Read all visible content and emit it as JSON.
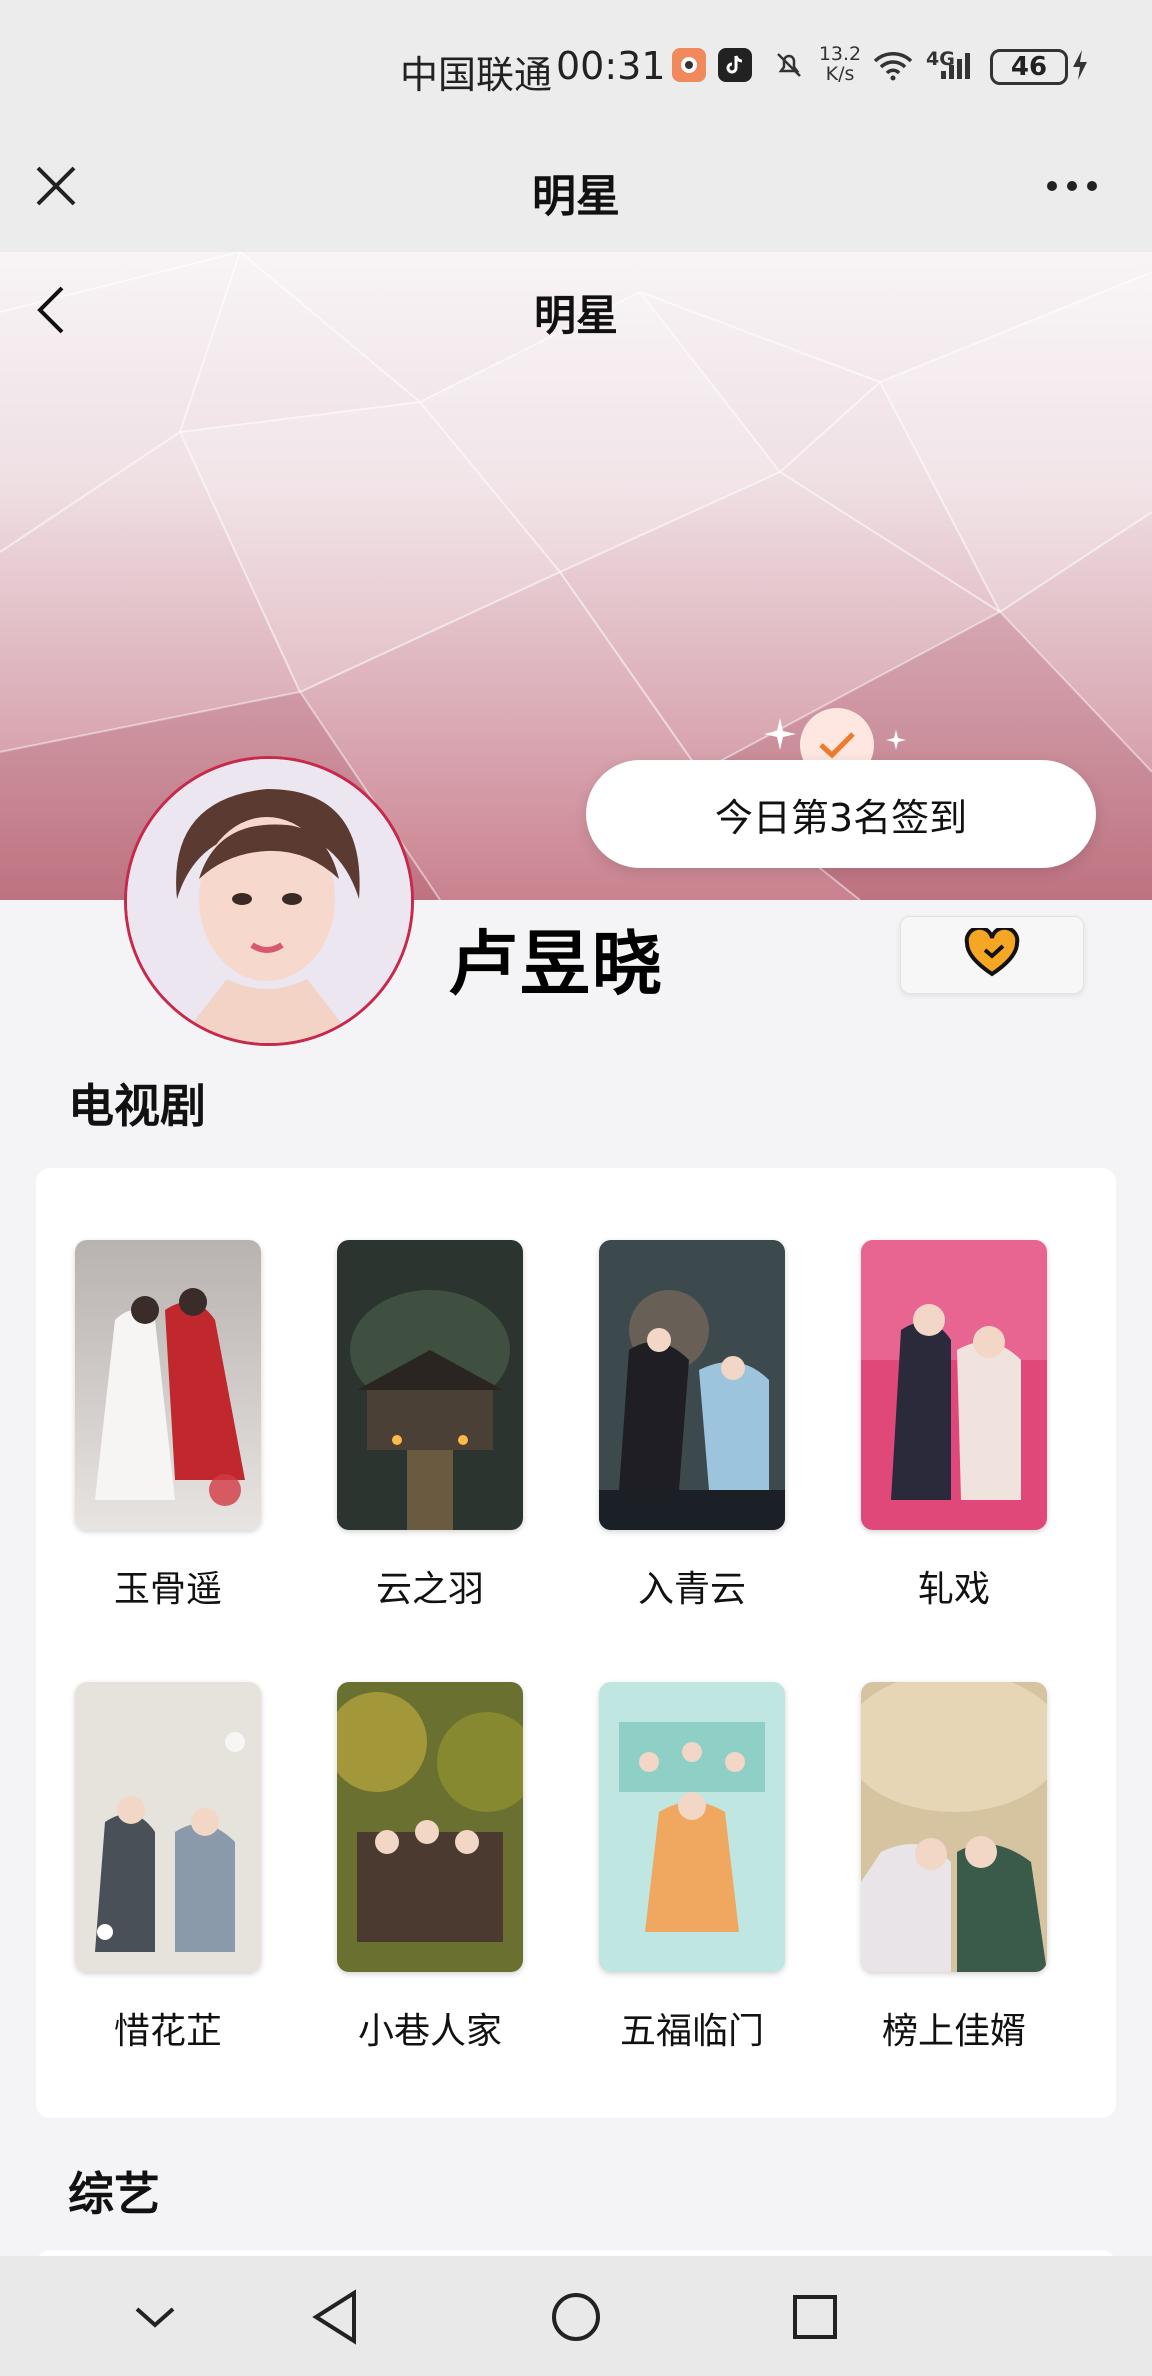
{
  "status_bar": {
    "carrier": "中国联通",
    "time": "00:31",
    "net_speed_value": "13.2",
    "net_speed_unit": "K/s",
    "network_type": "4G",
    "battery": "46",
    "icons": [
      "app-notification-icon",
      "tiktok-icon",
      "mute-icon",
      "wifi-icon",
      "signal-icon",
      "battery-icon",
      "charging-icon"
    ]
  },
  "topbar": {
    "title": "明星",
    "close_icon": "close-icon",
    "more_icon": "more-icon"
  },
  "banner": {
    "title": "明星",
    "back_icon": "back-icon"
  },
  "checkin": {
    "text": "今日第3名签到",
    "icon": "check-icon"
  },
  "star": {
    "name": "卢昱晓"
  },
  "follow": {
    "icon": "heart-icon",
    "color": "#f5a623"
  },
  "dramas_section": {
    "title": "电视剧",
    "items": [
      {
        "title": "玉骨遥"
      },
      {
        "title": "云之羽"
      },
      {
        "title": "入青云"
      },
      {
        "title": "轧戏"
      },
      {
        "title": "惜花芷"
      },
      {
        "title": "小巷人家"
      },
      {
        "title": "五福临门"
      },
      {
        "title": "榜上佳婿"
      }
    ]
  },
  "variety_section": {
    "title": "综艺"
  },
  "system_nav": {
    "icons": [
      "down-chevron-icon",
      "back-triangle-icon",
      "home-circle-icon",
      "recents-square-icon"
    ]
  },
  "colors": {
    "accent": "#c8284a",
    "banner": "#d49aa6",
    "gold": "#f5a623"
  }
}
